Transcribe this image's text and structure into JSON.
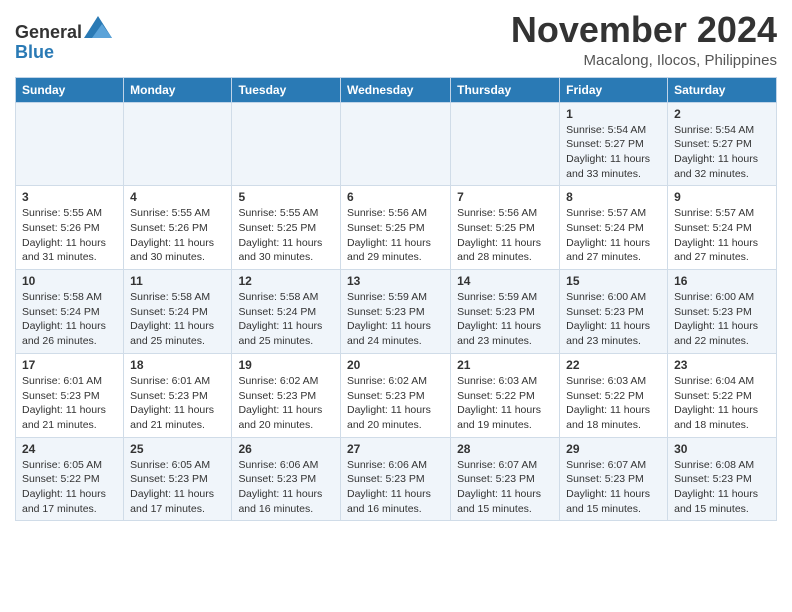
{
  "header": {
    "logo_line1": "General",
    "logo_line2": "Blue",
    "month": "November 2024",
    "location": "Macalong, Ilocos, Philippines"
  },
  "days_of_week": [
    "Sunday",
    "Monday",
    "Tuesday",
    "Wednesday",
    "Thursday",
    "Friday",
    "Saturday"
  ],
  "weeks": [
    [
      {
        "day": "",
        "info": ""
      },
      {
        "day": "",
        "info": ""
      },
      {
        "day": "",
        "info": ""
      },
      {
        "day": "",
        "info": ""
      },
      {
        "day": "",
        "info": ""
      },
      {
        "day": "1",
        "info": "Sunrise: 5:54 AM\nSunset: 5:27 PM\nDaylight: 11 hours and 33 minutes."
      },
      {
        "day": "2",
        "info": "Sunrise: 5:54 AM\nSunset: 5:27 PM\nDaylight: 11 hours and 32 minutes."
      }
    ],
    [
      {
        "day": "3",
        "info": "Sunrise: 5:55 AM\nSunset: 5:26 PM\nDaylight: 11 hours and 31 minutes."
      },
      {
        "day": "4",
        "info": "Sunrise: 5:55 AM\nSunset: 5:26 PM\nDaylight: 11 hours and 30 minutes."
      },
      {
        "day": "5",
        "info": "Sunrise: 5:55 AM\nSunset: 5:25 PM\nDaylight: 11 hours and 30 minutes."
      },
      {
        "day": "6",
        "info": "Sunrise: 5:56 AM\nSunset: 5:25 PM\nDaylight: 11 hours and 29 minutes."
      },
      {
        "day": "7",
        "info": "Sunrise: 5:56 AM\nSunset: 5:25 PM\nDaylight: 11 hours and 28 minutes."
      },
      {
        "day": "8",
        "info": "Sunrise: 5:57 AM\nSunset: 5:24 PM\nDaylight: 11 hours and 27 minutes."
      },
      {
        "day": "9",
        "info": "Sunrise: 5:57 AM\nSunset: 5:24 PM\nDaylight: 11 hours and 27 minutes."
      }
    ],
    [
      {
        "day": "10",
        "info": "Sunrise: 5:58 AM\nSunset: 5:24 PM\nDaylight: 11 hours and 26 minutes."
      },
      {
        "day": "11",
        "info": "Sunrise: 5:58 AM\nSunset: 5:24 PM\nDaylight: 11 hours and 25 minutes."
      },
      {
        "day": "12",
        "info": "Sunrise: 5:58 AM\nSunset: 5:24 PM\nDaylight: 11 hours and 25 minutes."
      },
      {
        "day": "13",
        "info": "Sunrise: 5:59 AM\nSunset: 5:23 PM\nDaylight: 11 hours and 24 minutes."
      },
      {
        "day": "14",
        "info": "Sunrise: 5:59 AM\nSunset: 5:23 PM\nDaylight: 11 hours and 23 minutes."
      },
      {
        "day": "15",
        "info": "Sunrise: 6:00 AM\nSunset: 5:23 PM\nDaylight: 11 hours and 23 minutes."
      },
      {
        "day": "16",
        "info": "Sunrise: 6:00 AM\nSunset: 5:23 PM\nDaylight: 11 hours and 22 minutes."
      }
    ],
    [
      {
        "day": "17",
        "info": "Sunrise: 6:01 AM\nSunset: 5:23 PM\nDaylight: 11 hours and 21 minutes."
      },
      {
        "day": "18",
        "info": "Sunrise: 6:01 AM\nSunset: 5:23 PM\nDaylight: 11 hours and 21 minutes."
      },
      {
        "day": "19",
        "info": "Sunrise: 6:02 AM\nSunset: 5:23 PM\nDaylight: 11 hours and 20 minutes."
      },
      {
        "day": "20",
        "info": "Sunrise: 6:02 AM\nSunset: 5:23 PM\nDaylight: 11 hours and 20 minutes."
      },
      {
        "day": "21",
        "info": "Sunrise: 6:03 AM\nSunset: 5:22 PM\nDaylight: 11 hours and 19 minutes."
      },
      {
        "day": "22",
        "info": "Sunrise: 6:03 AM\nSunset: 5:22 PM\nDaylight: 11 hours and 18 minutes."
      },
      {
        "day": "23",
        "info": "Sunrise: 6:04 AM\nSunset: 5:22 PM\nDaylight: 11 hours and 18 minutes."
      }
    ],
    [
      {
        "day": "24",
        "info": "Sunrise: 6:05 AM\nSunset: 5:22 PM\nDaylight: 11 hours and 17 minutes."
      },
      {
        "day": "25",
        "info": "Sunrise: 6:05 AM\nSunset: 5:23 PM\nDaylight: 11 hours and 17 minutes."
      },
      {
        "day": "26",
        "info": "Sunrise: 6:06 AM\nSunset: 5:23 PM\nDaylight: 11 hours and 16 minutes."
      },
      {
        "day": "27",
        "info": "Sunrise: 6:06 AM\nSunset: 5:23 PM\nDaylight: 11 hours and 16 minutes."
      },
      {
        "day": "28",
        "info": "Sunrise: 6:07 AM\nSunset: 5:23 PM\nDaylight: 11 hours and 15 minutes."
      },
      {
        "day": "29",
        "info": "Sunrise: 6:07 AM\nSunset: 5:23 PM\nDaylight: 11 hours and 15 minutes."
      },
      {
        "day": "30",
        "info": "Sunrise: 6:08 AM\nSunset: 5:23 PM\nDaylight: 11 hours and 15 minutes."
      }
    ]
  ]
}
